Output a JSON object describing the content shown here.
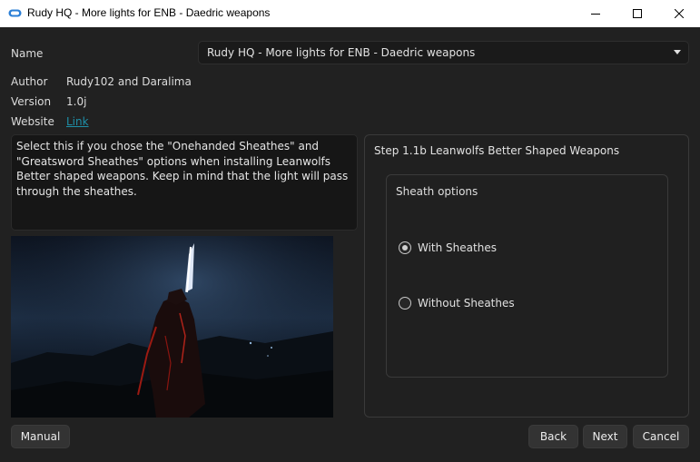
{
  "window": {
    "title": "Rudy HQ - More lights for ENB - Daedric weapons",
    "icon": "app-cloud-icon",
    "controls": [
      "minimize-icon",
      "maximize-icon",
      "close-icon"
    ]
  },
  "info": {
    "name_label": "Name",
    "name_value": "Rudy HQ - More lights for ENB - Daedric weapons",
    "author_label": "Author",
    "author_value": "Rudy102 and Daralima",
    "version_label": "Version",
    "version_value": "1.0j",
    "website_label": "Website",
    "website_link": "Link"
  },
  "description": "Select this if you chose the \"Onehanded Sheathes\" and \"Greatsword Sheathes\" options when installing Leanwolfs Better shaped weapons. Keep in mind that the light will pass through the sheathes.",
  "step": {
    "title": "Step 1.1b Leanwolfs Better Shaped Weapons",
    "group_title": "Sheath options",
    "options": [
      {
        "label": "With Sheathes",
        "selected": true
      },
      {
        "label": "Without Sheathes",
        "selected": false
      }
    ]
  },
  "buttons": {
    "manual": "Manual",
    "back": "Back",
    "next": "Next",
    "cancel": "Cancel"
  },
  "colors": {
    "background": "#212121",
    "link": "#1e8fa8",
    "titlebar": "#ffffff"
  }
}
